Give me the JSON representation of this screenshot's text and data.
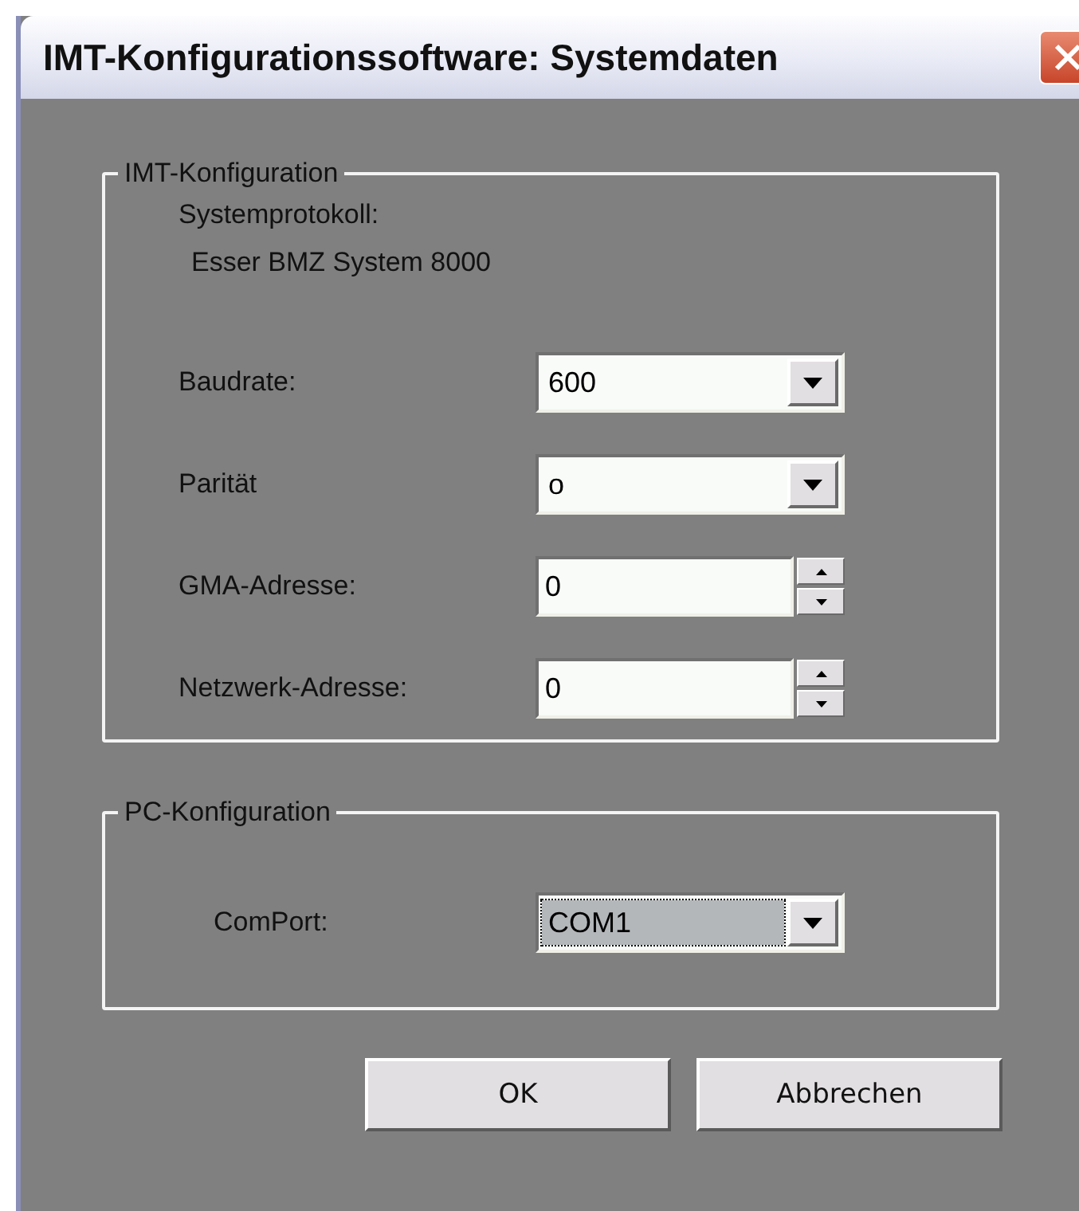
{
  "window": {
    "title": "IMT-Konfigurationssoftware: Systemdaten"
  },
  "groups": [
    {
      "title": "IMT-Konfiguration",
      "info": [
        {
          "text": "Systemprotokoll:",
          "kind": "label"
        },
        {
          "text": "Esser BMZ System 8000",
          "kind": "value"
        }
      ],
      "fields": [
        {
          "label": "Baudrate:",
          "kind": "combo",
          "value": "600",
          "focused": false
        },
        {
          "label": "Parität",
          "kind": "combo",
          "value": "o",
          "focused": false
        },
        {
          "label": "GMA-Adresse:",
          "kind": "spin",
          "value": "0",
          "focused": false
        },
        {
          "label": "Netzwerk-Adresse:",
          "kind": "spin",
          "value": "0",
          "focused": false
        }
      ]
    },
    {
      "title": "PC-Konfiguration",
      "fields": [
        {
          "label": "ComPort:",
          "kind": "combo",
          "value": "COM1",
          "focused": true
        }
      ]
    }
  ],
  "buttons": [
    "OK",
    "Abbrechen"
  ]
}
